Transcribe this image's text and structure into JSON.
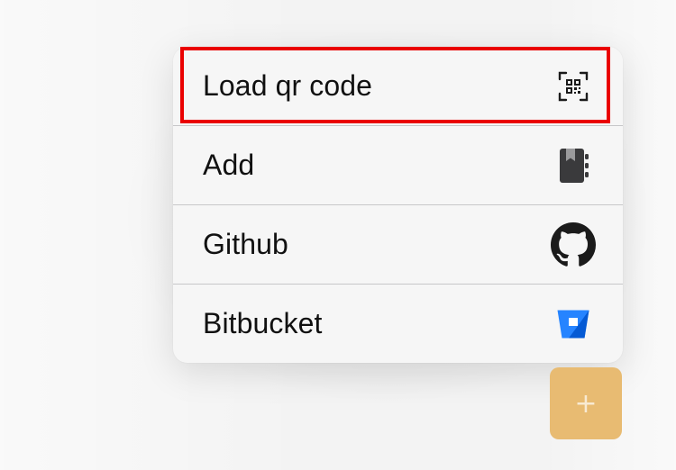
{
  "menu": {
    "items": [
      {
        "label": "Load qr code",
        "icon": "qr-code-scan-icon"
      },
      {
        "label": "Add",
        "icon": "address-book-icon"
      },
      {
        "label": "Github",
        "icon": "github-icon"
      },
      {
        "label": "Bitbucket",
        "icon": "bitbucket-icon"
      }
    ]
  },
  "fab": {
    "label": "+",
    "icon": "plus-icon",
    "color": "#e8bb72"
  },
  "colors": {
    "highlight": "#ea0000",
    "bitbucket": "#2684ff",
    "github": "#1b1b1b"
  }
}
